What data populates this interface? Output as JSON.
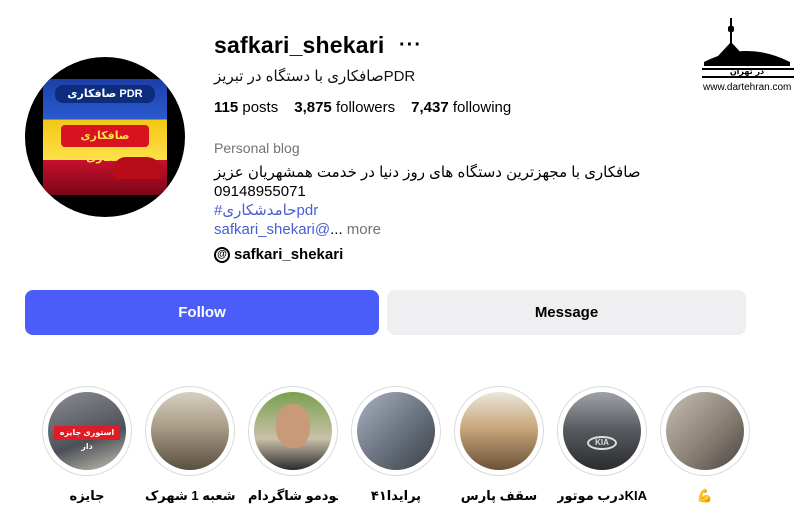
{
  "profile": {
    "username": "safkari_shekari",
    "more_label": "···",
    "full_name": "صافکاری با دستگاه در تبریزPDR",
    "stats": {
      "posts_count": "115",
      "posts_label": "posts",
      "followers_count": "3,875",
      "followers_label": "followers",
      "following_count": "7,437",
      "following_label": "following"
    },
    "category": "Personal blog",
    "bio": {
      "line1": "صافکاری با مجهزترین دستگاه های روز دنیا در خدمت همشهریان عزیز",
      "phone": "09148955071",
      "hashtag": "#حامدشکاریpdr",
      "mention": "safkari_shekari@",
      "ellipsis": "...",
      "more": " more"
    },
    "threads_handle": "safkari_shekari",
    "avatar_text": {
      "top": "صافکاری PDR",
      "middle": "صافکاری شکاری"
    }
  },
  "actions": {
    "follow_label": "Follow",
    "message_label": "Message"
  },
  "watermark": {
    "logo_text": "در تهران",
    "site": "www.dartehran.com"
  },
  "highlights": [
    {
      "label": "جایزه",
      "badge": "استوری جایزه دار",
      "color": "#6b6f75"
    },
    {
      "label": "شعبه 1 شهرک ...",
      "color": "#9b8f7f"
    },
    {
      "label": "خودمو شاگردام",
      "color": "#5f8a3d"
    },
    {
      "label": "پرایدا۴۱",
      "color": "#8d96a4"
    },
    {
      "label": "سقف پارس",
      "color": "#b89a74"
    },
    {
      "label": "درب موتورKIA",
      "color": "#7a7d83"
    },
    {
      "label": "💪",
      "color": "#a8a39a"
    }
  ],
  "colors": {
    "follow_bg": "#4a5df9",
    "message_bg": "#efeff1",
    "link": "#4a5dd5",
    "muted": "#737373"
  }
}
